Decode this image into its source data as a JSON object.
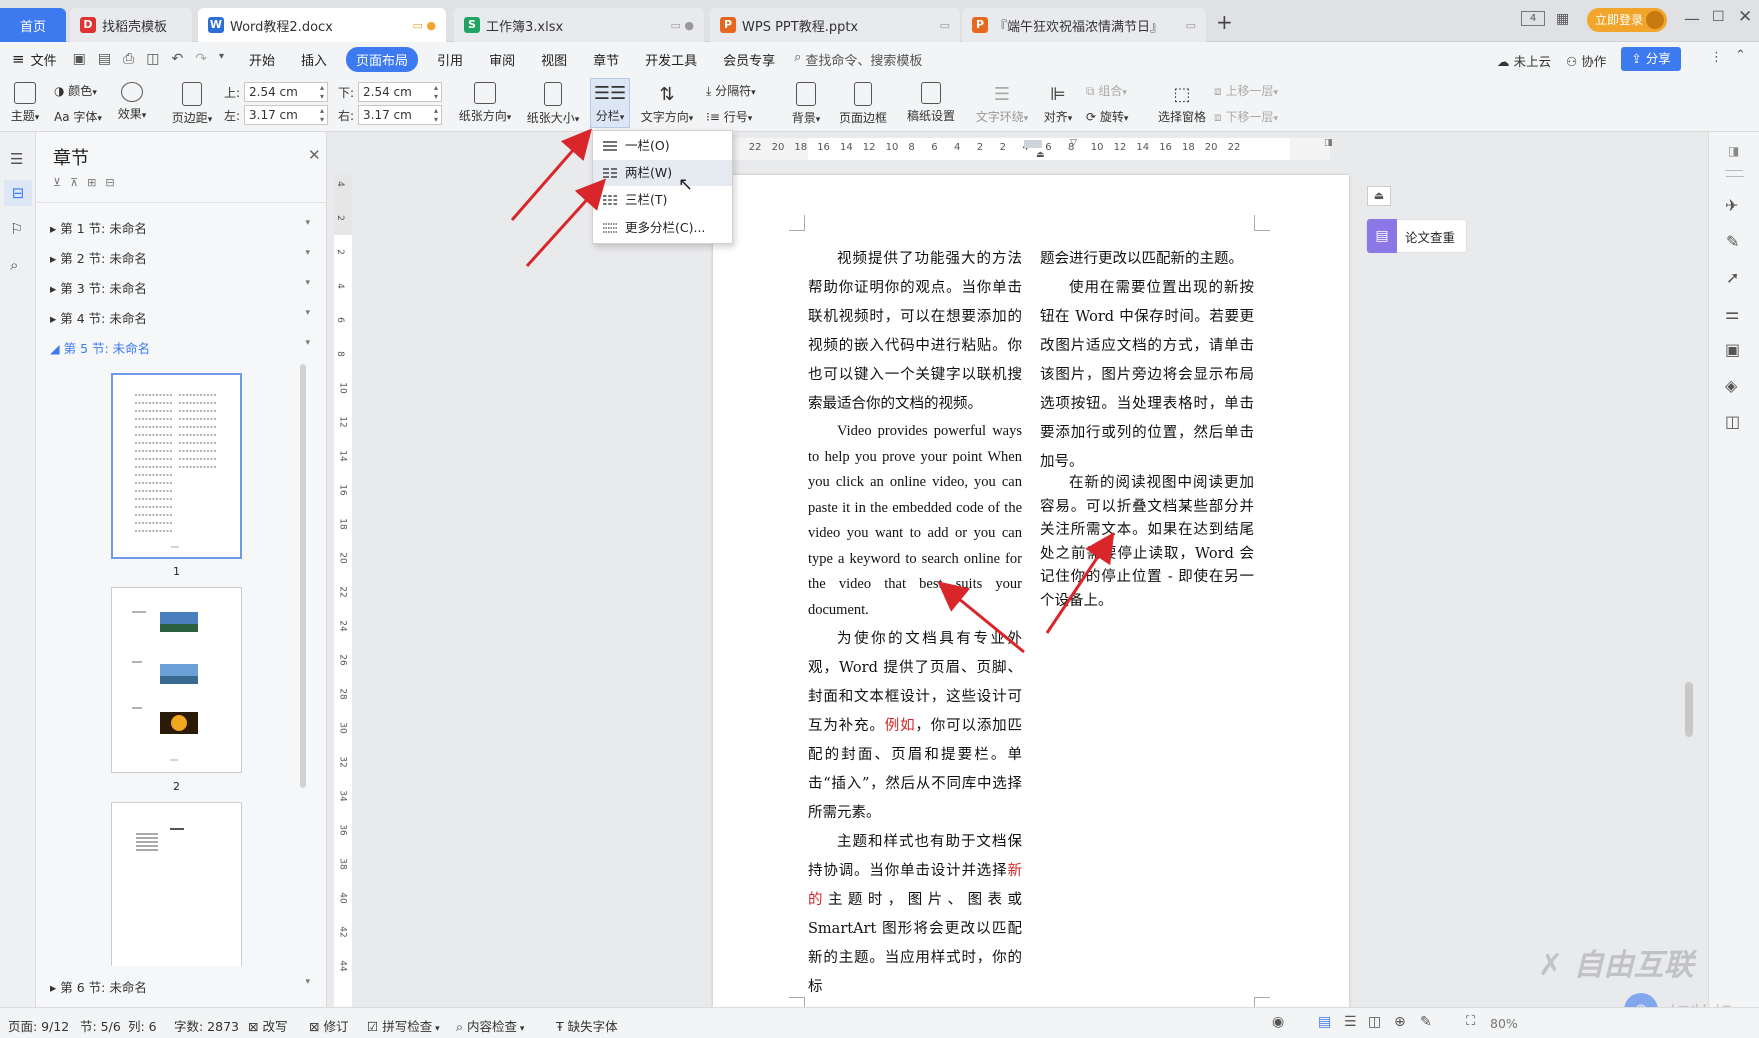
{
  "tabs": {
    "home": "首页",
    "items": [
      {
        "label": "找稻壳模板",
        "icon": "docer-icon",
        "color": "#d33"
      },
      {
        "label": "Word教程2.docx",
        "icon": "word-icon",
        "color": "#2b6fd6"
      },
      {
        "label": "工作簿3.xlsx",
        "icon": "excel-icon",
        "color": "#1fa463"
      },
      {
        "label": "WPS PPT教程.pptx",
        "icon": "ppt-icon",
        "color": "#e8671f"
      },
      {
        "label": "『端午狂欢祝福浓情满节日』",
        "icon": "ppt-icon",
        "color": "#e8671f"
      }
    ],
    "new_tab": "+",
    "login": "立即登录",
    "window_badge": "4"
  },
  "menu": {
    "file": "文件",
    "items": [
      "开始",
      "插入",
      "页面布局",
      "引用",
      "审阅",
      "视图",
      "章节",
      "开发工具",
      "会员专享"
    ],
    "active": "页面布局",
    "search": "查找命令、搜索模板",
    "cloud": "未上云",
    "collab": "协作",
    "share": "分享"
  },
  "ribbon": {
    "theme": "主题",
    "color": "颜色",
    "font": "字体",
    "effect": "效果",
    "margin": "页边距",
    "top_label": "上:",
    "top_val": "2.54 cm",
    "bottom_label": "下:",
    "bottom_val": "2.54 cm",
    "left_label": "左:",
    "left_val": "3.17 cm",
    "right_label": "右:",
    "right_val": "3.17 cm",
    "orientation": "纸张方向",
    "size": "纸张大小",
    "columns": "分栏",
    "text_dir": "文字方向",
    "breaks": "分隔符",
    "line_no": "行号",
    "background": "背景",
    "border": "页面边框",
    "manuscript": "稿纸设置",
    "wrap": "文字环绕",
    "align": "对齐",
    "group": "组合",
    "rotate": "旋转",
    "select_pane": "选择窗格",
    "up": "上移一层",
    "down": "下移一层"
  },
  "columns_menu": {
    "items": [
      "一栏(O)",
      "两栏(W)",
      "三栏(T)",
      "更多分栏(C)..."
    ],
    "hovered": "两栏(W)"
  },
  "sidebar": {
    "title": "章节",
    "sections": [
      "第 1 节: 未命名",
      "第 2 节: 未命名",
      "第 3 节: 未命名",
      "第 4 节: 未命名",
      "第 5 节: 未命名"
    ],
    "active_section": "第 5 节: 未命名",
    "last_section": "第 6 节: 未命名",
    "page_nums": [
      "1",
      "2"
    ]
  },
  "ruler": {
    "h_ticks": [
      "4",
      "22",
      "20",
      "18",
      "16",
      "14",
      "12",
      "10",
      "8",
      "6",
      "4",
      "2",
      "2",
      "4",
      "6",
      "8",
      "10",
      "12",
      "14",
      "16",
      "18",
      "20",
      "22"
    ],
    "v_ticks": [
      "4",
      "2",
      "2",
      "4",
      "6",
      "8",
      "10",
      "12",
      "14",
      "16",
      "18",
      "20",
      "22",
      "24",
      "26",
      "28",
      "30",
      "32",
      "34",
      "36",
      "38",
      "40",
      "42",
      "44"
    ]
  },
  "document": {
    "left_col": {
      "p1": "视频提供了功能强大的方法帮助你证明你的观点。当你单击联机视频时，可以在想要添加的视频的嵌入代码中进行粘贴。你也可以键入一个关键字以联机搜索最适合你的文档的视频。",
      "p2": "Video provides powerful ways to help you prove your point When you click an online video, you can paste it in the embedded code of the video you want to add or you can type a keyword to search online for the video that best suits your document.",
      "p3_a": "为使你的文档具有专业外观，Word 提供了页眉、页脚、封面和文本框设计，这些设计可互为补充。",
      "p3_red": "例如",
      "p3_b": "，你可以添加匹配的封面、页眉和提要栏。单击“插入”，然后从不同库中选择所需元素。",
      "p4_a": "主题和样式也有助于文档保持协调。当你单击设计并选择",
      "p4_red": "新的",
      "p4_b": "主题时，图片、图表或 SmartArt 图形将会更改以匹配新的主题。当应用样式时，你的标"
    },
    "right_col": {
      "p1": "题会进行更改以匹配新的主题。",
      "p2": "使用在需要位置出现的新按钮在 Word 中保存时间。若要更改图片适应文档的方式，请单击该图片，图片旁边将会显示布局选项按钮。当处理表格时，单击要添加行或列的位置，然后单击加号。",
      "p3": "在新的阅读视图中阅读更加容易。可以折叠文档某些部分并关注所需文本。如果在达到结尾处之前需要停止读取，Word 会记住你的停止位置 - 即使在另一个设备上。"
    }
  },
  "right_panel": {
    "plagiarism": "论文查重"
  },
  "status": {
    "page": "页面: 9/12",
    "section": "节: 5/6",
    "col": "列: 6",
    "words": "字数: 2873",
    "rewrite": "改写",
    "track": "修订",
    "spell": "拼写检查",
    "content": "内容检查",
    "missing_font": "缺失字体",
    "zoom": "80%"
  },
  "watermark": {
    "text1": "自由互联",
    "text2": "好装机"
  },
  "colors": {
    "accent": "#3d7af0",
    "annotation_arrow": "#d9262b",
    "login": "#f1a52b"
  }
}
